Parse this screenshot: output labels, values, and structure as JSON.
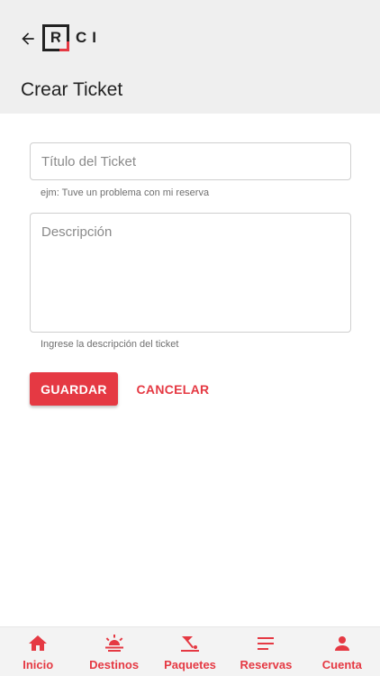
{
  "header": {
    "logo_r": "R",
    "logo_rest": "CI",
    "title": "Crear Ticket"
  },
  "form": {
    "title_field": {
      "placeholder": "Título del Ticket",
      "value": "",
      "hint": "ejm: Tuve un problema con mi reserva"
    },
    "description_field": {
      "placeholder": "Descripción",
      "value": "",
      "hint": "Ingrese la descripción del ticket"
    },
    "save_label": "GUARDAR",
    "cancel_label": "CANCELAR"
  },
  "bottom_nav": {
    "items": [
      {
        "label": "Inicio",
        "icon": "home-icon"
      },
      {
        "label": "Destinos",
        "icon": "sunset-icon"
      },
      {
        "label": "Paquetes",
        "icon": "beach-umbrella-icon"
      },
      {
        "label": "Reservas",
        "icon": "list-icon"
      },
      {
        "label": "Cuenta",
        "icon": "person-icon"
      }
    ]
  },
  "colors": {
    "accent": "#e53943",
    "header_bg": "#efefef"
  }
}
